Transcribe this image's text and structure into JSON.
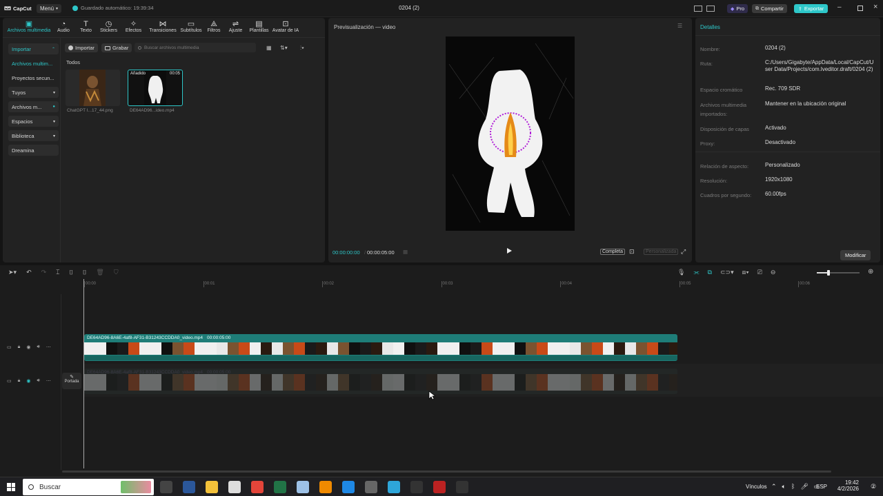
{
  "app": {
    "logo": "CapCut",
    "menu_label": "Menú",
    "autosave": "Guardado automático: 19:39:34",
    "title": "0204 (2)",
    "pro_label": "Pro",
    "share_label": "Compartir",
    "export_label": "Exportar"
  },
  "toolbar": {
    "items": [
      {
        "label": "Archivos multimedia",
        "icon": "media-icon"
      },
      {
        "label": "Audio",
        "icon": "audio-icon"
      },
      {
        "label": "Texto",
        "icon": "text-icon"
      },
      {
        "label": "Stickers",
        "icon": "sticker-icon"
      },
      {
        "label": "Efectos",
        "icon": "effects-icon"
      },
      {
        "label": "Transiciones",
        "icon": "transitions-icon"
      },
      {
        "label": "Subtítulos",
        "icon": "subtitles-icon"
      },
      {
        "label": "Filtros",
        "icon": "filters-icon"
      },
      {
        "label": "Ajuste",
        "icon": "adjust-icon"
      },
      {
        "label": "Plantillas",
        "icon": "templates-icon"
      },
      {
        "label": "Avatar de IA",
        "icon": "avatar-icon"
      }
    ]
  },
  "sidebar": {
    "items": [
      {
        "label": "Importar"
      },
      {
        "label": "Archivos multim..."
      },
      {
        "label": "Proyectos secun..."
      },
      {
        "label": "Tuyos"
      },
      {
        "label": "Archivos m..."
      },
      {
        "label": "Espacios"
      },
      {
        "label": "Biblioteca"
      },
      {
        "label": "Dreamina"
      }
    ]
  },
  "media": {
    "import_label": "Importar",
    "record_label": "Grabar",
    "search_placeholder": "Buscar archivos multimedia",
    "section_label": "Todos",
    "files": [
      {
        "name": "ChatGPT I...17_44.png"
      },
      {
        "name": "DE64AD96...ideo.mp4",
        "badge": "Añadido",
        "duration": "00:05"
      }
    ]
  },
  "preview": {
    "title": "Previsualización — video",
    "current_time": "00:00:00:00",
    "total_time": "00:00:05:00",
    "complete_label": "Completa",
    "custom_label": "Personalizada"
  },
  "details": {
    "title": "Detalles",
    "rows": [
      {
        "key": "Nombre:",
        "value": "0204 (2)"
      },
      {
        "key": "Ruta:",
        "value": "C:/Users/Gigabyte/AppData/Local/CapCut/User Data/Projects/com.lveditor.draft/0204 (2)"
      },
      {
        "key": "Espacio cromático",
        "value": "Rec. 709 SDR"
      },
      {
        "key": "Archivos multimedia importados:",
        "value": "Mantener en la ubicación original"
      },
      {
        "key": "Disposición de capas",
        "value": "Activado"
      },
      {
        "key": "Proxy:",
        "value": "Desactivado"
      },
      {
        "key": "Relación de aspecto:",
        "value": "Personalizado"
      },
      {
        "key": "Resolución:",
        "value": "1920x1080"
      },
      {
        "key": "Cuadros por segundo:",
        "value": "60.00fps"
      }
    ],
    "modify_label": "Modificar"
  },
  "timeline": {
    "ruler": [
      "00:00",
      "00:01",
      "00:02",
      "00:03",
      "00:04",
      "00:05",
      "00:06"
    ],
    "clip_label": "DE64AD96-8A6E-4af8-AF31-B31243CCDDA0_video.mp4",
    "clip_duration": "00:00:05:00",
    "cover_label": "Portada"
  },
  "taskbar": {
    "search_label": "Buscar",
    "links_label": "Vínculos",
    "lang": "ESP",
    "time": "19:42",
    "date": "4/2/2026"
  },
  "colors": {
    "accent": "#2ec7c9",
    "clip": "#1e7d78",
    "pro": "#7b6cf0"
  }
}
